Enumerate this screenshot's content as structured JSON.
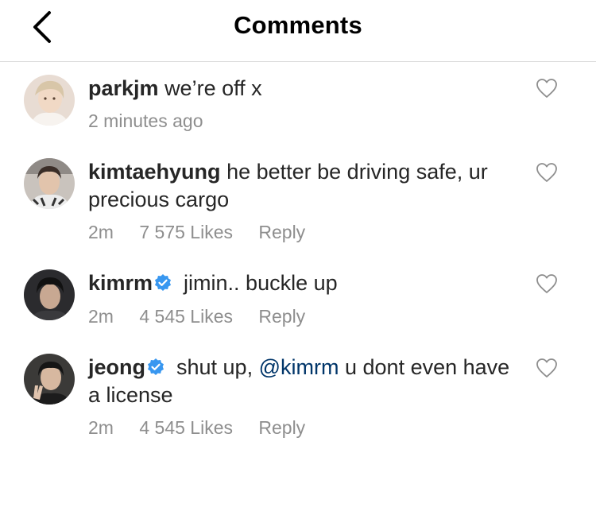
{
  "header": {
    "title": "Comments",
    "back_icon": "chevron-left-icon"
  },
  "colors": {
    "text": "#262626",
    "meta": "#8e8e8e",
    "mention": "#003569",
    "verified": "#3897f0",
    "divider": "#dbdbdb"
  },
  "comments": [
    {
      "username": "parkjm",
      "verified": false,
      "text": "we’re off x",
      "time": "2 minutes ago"
    },
    {
      "username": "kimtaehyung",
      "verified": false,
      "text": "he better be driving safe, ur precious cargo",
      "time": "2m",
      "likes": "7 575 Likes",
      "reply": "Reply"
    },
    {
      "username": "kimrm",
      "verified": true,
      "text": "jimin.. buckle up",
      "time": "2m",
      "likes": "4 545 Likes",
      "reply": "Reply"
    },
    {
      "username": "jeong",
      "verified": true,
      "text_before": "shut up,",
      "mention": "@kimrm",
      "text_after": "u dont even have a license",
      "time": "2m",
      "likes": "4 545 Likes",
      "reply": "Reply"
    }
  ]
}
